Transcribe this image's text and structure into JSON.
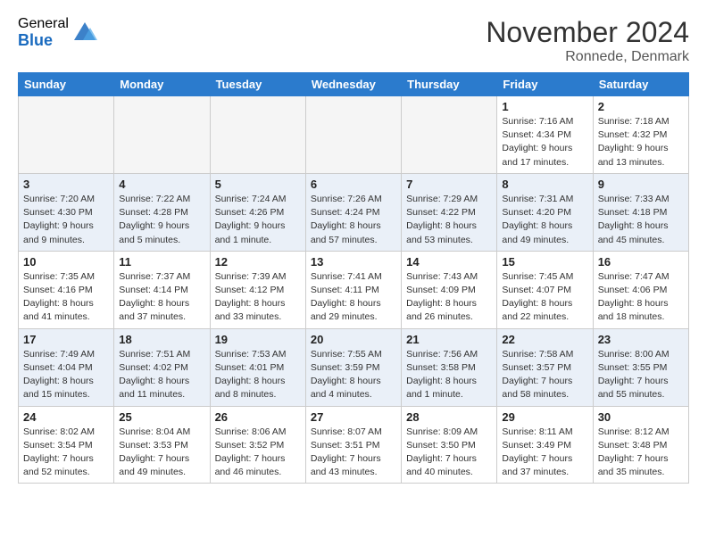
{
  "header": {
    "logo_general": "General",
    "logo_blue": "Blue",
    "month_title": "November 2024",
    "location": "Ronnede, Denmark"
  },
  "weekdays": [
    "Sunday",
    "Monday",
    "Tuesday",
    "Wednesday",
    "Thursday",
    "Friday",
    "Saturday"
  ],
  "weeks": [
    [
      {
        "day": "",
        "info": ""
      },
      {
        "day": "",
        "info": ""
      },
      {
        "day": "",
        "info": ""
      },
      {
        "day": "",
        "info": ""
      },
      {
        "day": "",
        "info": ""
      },
      {
        "day": "1",
        "info": "Sunrise: 7:16 AM\nSunset: 4:34 PM\nDaylight: 9 hours and 17 minutes."
      },
      {
        "day": "2",
        "info": "Sunrise: 7:18 AM\nSunset: 4:32 PM\nDaylight: 9 hours and 13 minutes."
      }
    ],
    [
      {
        "day": "3",
        "info": "Sunrise: 7:20 AM\nSunset: 4:30 PM\nDaylight: 9 hours and 9 minutes."
      },
      {
        "day": "4",
        "info": "Sunrise: 7:22 AM\nSunset: 4:28 PM\nDaylight: 9 hours and 5 minutes."
      },
      {
        "day": "5",
        "info": "Sunrise: 7:24 AM\nSunset: 4:26 PM\nDaylight: 9 hours and 1 minute."
      },
      {
        "day": "6",
        "info": "Sunrise: 7:26 AM\nSunset: 4:24 PM\nDaylight: 8 hours and 57 minutes."
      },
      {
        "day": "7",
        "info": "Sunrise: 7:29 AM\nSunset: 4:22 PM\nDaylight: 8 hours and 53 minutes."
      },
      {
        "day": "8",
        "info": "Sunrise: 7:31 AM\nSunset: 4:20 PM\nDaylight: 8 hours and 49 minutes."
      },
      {
        "day": "9",
        "info": "Sunrise: 7:33 AM\nSunset: 4:18 PM\nDaylight: 8 hours and 45 minutes."
      }
    ],
    [
      {
        "day": "10",
        "info": "Sunrise: 7:35 AM\nSunset: 4:16 PM\nDaylight: 8 hours and 41 minutes."
      },
      {
        "day": "11",
        "info": "Sunrise: 7:37 AM\nSunset: 4:14 PM\nDaylight: 8 hours and 37 minutes."
      },
      {
        "day": "12",
        "info": "Sunrise: 7:39 AM\nSunset: 4:12 PM\nDaylight: 8 hours and 33 minutes."
      },
      {
        "day": "13",
        "info": "Sunrise: 7:41 AM\nSunset: 4:11 PM\nDaylight: 8 hours and 29 minutes."
      },
      {
        "day": "14",
        "info": "Sunrise: 7:43 AM\nSunset: 4:09 PM\nDaylight: 8 hours and 26 minutes."
      },
      {
        "day": "15",
        "info": "Sunrise: 7:45 AM\nSunset: 4:07 PM\nDaylight: 8 hours and 22 minutes."
      },
      {
        "day": "16",
        "info": "Sunrise: 7:47 AM\nSunset: 4:06 PM\nDaylight: 8 hours and 18 minutes."
      }
    ],
    [
      {
        "day": "17",
        "info": "Sunrise: 7:49 AM\nSunset: 4:04 PM\nDaylight: 8 hours and 15 minutes."
      },
      {
        "day": "18",
        "info": "Sunrise: 7:51 AM\nSunset: 4:02 PM\nDaylight: 8 hours and 11 minutes."
      },
      {
        "day": "19",
        "info": "Sunrise: 7:53 AM\nSunset: 4:01 PM\nDaylight: 8 hours and 8 minutes."
      },
      {
        "day": "20",
        "info": "Sunrise: 7:55 AM\nSunset: 3:59 PM\nDaylight: 8 hours and 4 minutes."
      },
      {
        "day": "21",
        "info": "Sunrise: 7:56 AM\nSunset: 3:58 PM\nDaylight: 8 hours and 1 minute."
      },
      {
        "day": "22",
        "info": "Sunrise: 7:58 AM\nSunset: 3:57 PM\nDaylight: 7 hours and 58 minutes."
      },
      {
        "day": "23",
        "info": "Sunrise: 8:00 AM\nSunset: 3:55 PM\nDaylight: 7 hours and 55 minutes."
      }
    ],
    [
      {
        "day": "24",
        "info": "Sunrise: 8:02 AM\nSunset: 3:54 PM\nDaylight: 7 hours and 52 minutes."
      },
      {
        "day": "25",
        "info": "Sunrise: 8:04 AM\nSunset: 3:53 PM\nDaylight: 7 hours and 49 minutes."
      },
      {
        "day": "26",
        "info": "Sunrise: 8:06 AM\nSunset: 3:52 PM\nDaylight: 7 hours and 46 minutes."
      },
      {
        "day": "27",
        "info": "Sunrise: 8:07 AM\nSunset: 3:51 PM\nDaylight: 7 hours and 43 minutes."
      },
      {
        "day": "28",
        "info": "Sunrise: 8:09 AM\nSunset: 3:50 PM\nDaylight: 7 hours and 40 minutes."
      },
      {
        "day": "29",
        "info": "Sunrise: 8:11 AM\nSunset: 3:49 PM\nDaylight: 7 hours and 37 minutes."
      },
      {
        "day": "30",
        "info": "Sunrise: 8:12 AM\nSunset: 3:48 PM\nDaylight: 7 hours and 35 minutes."
      }
    ]
  ]
}
